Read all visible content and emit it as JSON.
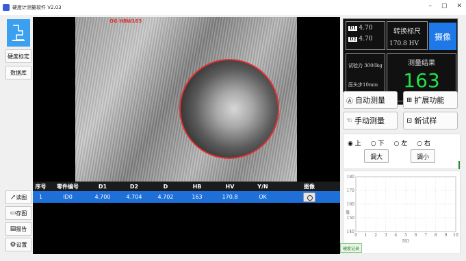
{
  "window": {
    "title": "硬度计测量软件 V2.03",
    "controls": {
      "minimize": "–",
      "maximize": "▢",
      "close": "✕"
    }
  },
  "sidebar": {
    "top": [
      {
        "label": "硬度标定"
      },
      {
        "label": "数据库"
      }
    ],
    "bottom": [
      {
        "label": "读图"
      },
      {
        "label": "存图"
      },
      {
        "label": "报告"
      },
      {
        "label": "设置"
      }
    ]
  },
  "viewer": {
    "overlay_label": "OG HBW163"
  },
  "table": {
    "headers": [
      "序号",
      "零件编号",
      "D1",
      "D2",
      "D",
      "HB",
      "HV",
      "Y/N",
      "图像"
    ],
    "rows": [
      [
        "1",
        "ID0",
        "4.700",
        "4.704",
        "4.702",
        "163",
        "170.8",
        "OK",
        ""
      ]
    ]
  },
  "status": {
    "d1_badge": "D1",
    "d1_value": "4.70",
    "d2_badge": "D2",
    "d2_value": "4.70",
    "convert_title": "转换标尺",
    "convert_value": "170.8  HV",
    "capture_label": "摄像",
    "load": "试验力 3000kg",
    "indenter": "压头步10mm",
    "result_title": "测量结果",
    "result_value": "163"
  },
  "actions": {
    "auto": "自动测量",
    "extend": "扩展功能",
    "manual": "手动测量",
    "new_sample": "新试样"
  },
  "direction": {
    "up": "上",
    "down": "下",
    "left": "左",
    "right": "右",
    "zoom_in": "调大",
    "zoom_out": "调小"
  },
  "chart_tab": "硬度记录",
  "chart_data": {
    "type": "line",
    "x": [],
    "series": [],
    "xlabel": "NO",
    "ylabel": "值",
    "xlim": [
      0,
      10
    ],
    "ylim": [
      140,
      180
    ],
    "xticks": [
      "0",
      "1",
      "2",
      "3",
      "4",
      "5",
      "6",
      "7",
      "8",
      "9",
      "10"
    ],
    "yticks": [
      "140",
      "150",
      "160",
      "170",
      "180"
    ],
    "grid": true
  }
}
